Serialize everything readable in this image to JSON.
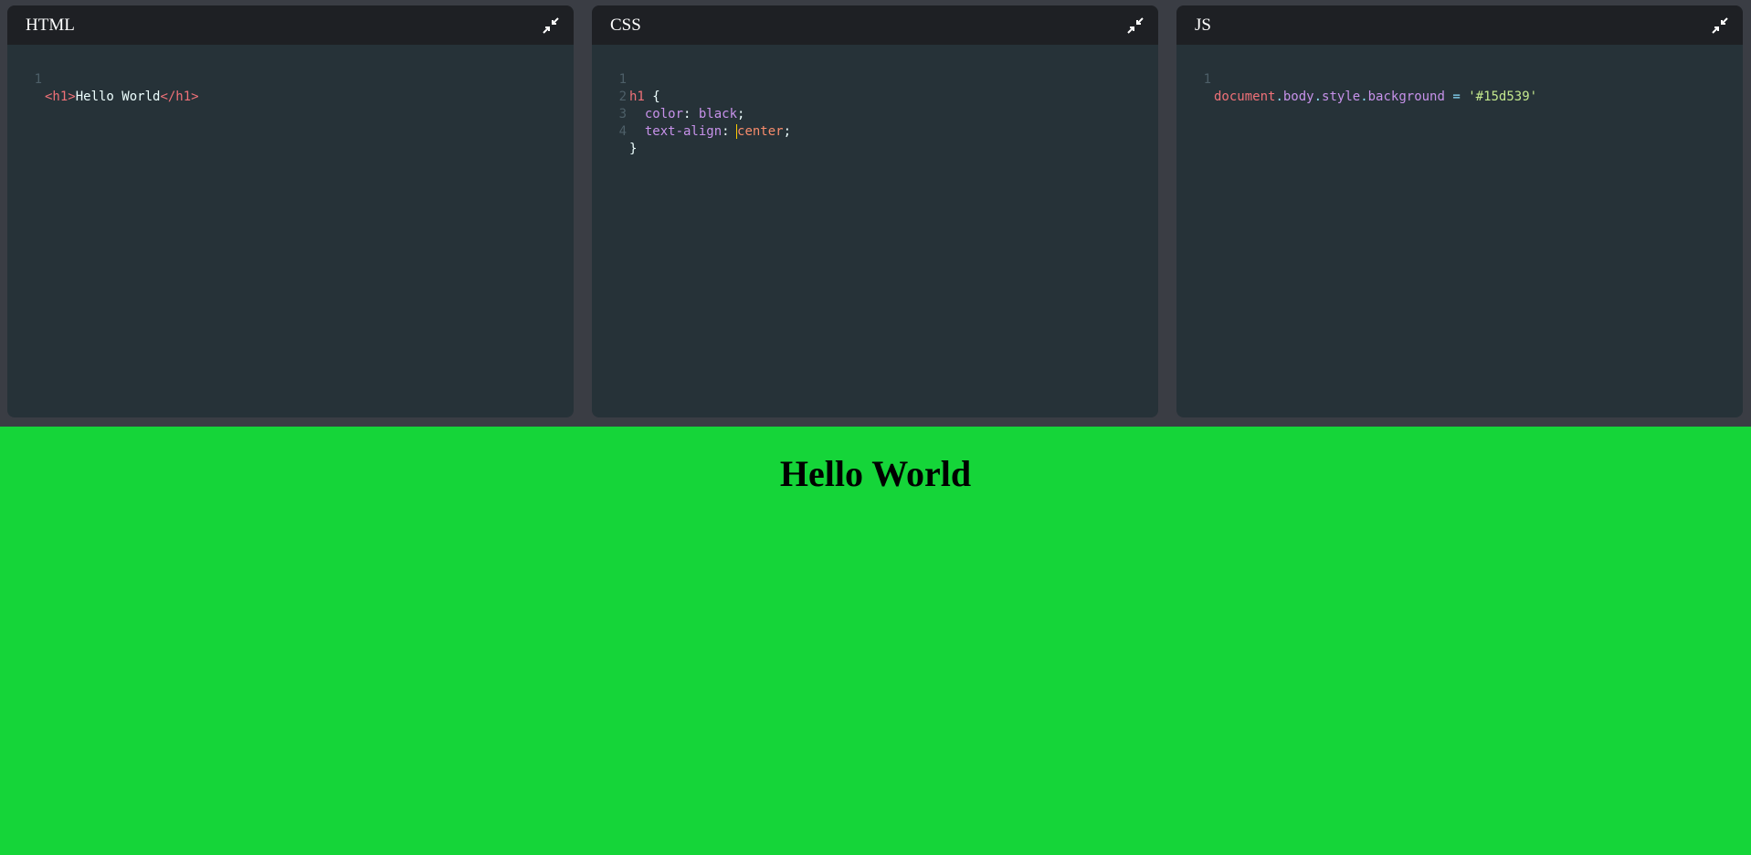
{
  "editors": {
    "html": {
      "title": "HTML",
      "lines": [
        {
          "num": "1",
          "tokens": [
            "<h1>",
            "Hello World",
            "</h1>"
          ]
        }
      ]
    },
    "css": {
      "title": "CSS",
      "lines": [
        {
          "num": "1",
          "tokens": [
            "h1",
            " {"
          ]
        },
        {
          "num": "2",
          "tokens": [
            "  color",
            ": ",
            "black",
            ";"
          ]
        },
        {
          "num": "3",
          "tokens": [
            "  text-align",
            ": ",
            "center",
            ";"
          ]
        },
        {
          "num": "4",
          "tokens": [
            "}"
          ]
        }
      ]
    },
    "js": {
      "title": "JS",
      "lines": [
        {
          "num": "1",
          "tokens": [
            "document",
            ".",
            "body",
            ".",
            "style",
            ".",
            "background",
            " = ",
            "'#15d539'"
          ]
        }
      ]
    }
  },
  "preview": {
    "heading": "Hello World",
    "background": "#15d539"
  },
  "icons": {
    "collapse": "collapse-arrows-icon"
  },
  "colors": {
    "editor_bg": "#263238",
    "header_bg": "#1e2024",
    "frame_bg": "#3a3d44",
    "preview_bg": "#15d539"
  }
}
